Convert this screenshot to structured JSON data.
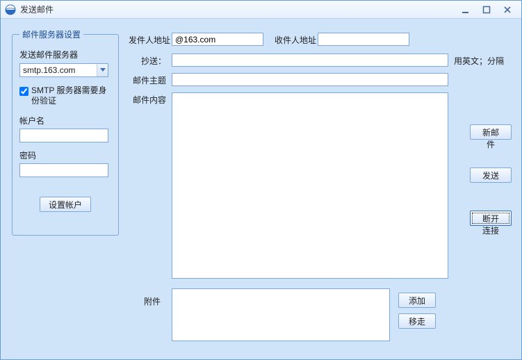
{
  "window": {
    "title": "发送邮件"
  },
  "server_group": {
    "legend": "邮件服务器设置",
    "smtp_label": "发送邮件服务器",
    "smtp_value": "smtp.163.com",
    "auth_label": "SMTP 服务器需要身份验证",
    "auth_checked": true,
    "account_label": "帐户名",
    "account_value": "",
    "password_label": "密码",
    "password_value": "",
    "set_account_btn": "设置帐户"
  },
  "form": {
    "from_label": "发件人地址",
    "from_value": "@163.com",
    "to_label": "收件人地址",
    "to_value": "",
    "cc_label": "抄送：",
    "cc_value": "",
    "cc_hint": "用英文；分隔",
    "subject_label": "邮件主题",
    "subject_value": "",
    "body_label": "邮件内容",
    "body_value": "",
    "attachment_label": "附件"
  },
  "buttons": {
    "new_mail": "新邮件",
    "send": "发送",
    "disconnect": "断开连接",
    "add": "添加",
    "remove": "移走"
  }
}
